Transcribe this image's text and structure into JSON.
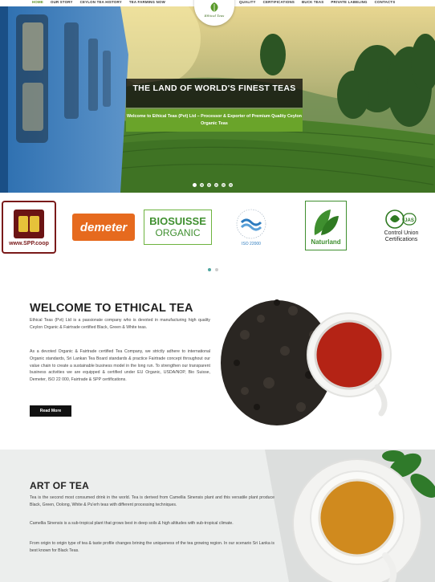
{
  "nav": {
    "left": [
      "HOME",
      "OUR STORY",
      "CEYLON TEA HISTORY",
      "TEA FARMING NOW"
    ],
    "right": [
      "QUALITY",
      "CERTIFICATIONS",
      "BUCK TEAS",
      "PRIVATE LABELING",
      "CONTACTS"
    ],
    "logo_text": "Ethical Teas"
  },
  "hero": {
    "title": "THE LAND OF WORLD'S FINEST TEAS",
    "subtitle": "Welcome to Ethical Teas (Pvt) Ltd – Processor & Exporter of Premium Quality Ceylon Organic Teas",
    "slide_count": 6,
    "active_slide": 1
  },
  "certifications": {
    "spp_label": "www.SPP.coop",
    "demeter_label": "demeter",
    "biosuisse_line1": "BIOSUISSE",
    "biosuisse_line2": "ORGANIC",
    "iso_label": "ISO 22000",
    "naturland_label": "Naturland",
    "cu_badge": "JAS",
    "cu_label_line1": "Control Union",
    "cu_label_line2": "Certifications",
    "page_count": 2,
    "active_page": 1
  },
  "welcome": {
    "title": "WELCOME TO ETHICAL TEA",
    "para1": "Ethical Teas (Pvt) Ltd is a passionate company who is devoted in manufacturing high quality Ceylon Organic & Fairtrade certified Black, Green & White teas.",
    "para2": "As a devoted Organic & Fairtrade certified Tea Company, we strictly adhere to international Organic standards, Sri Lankan Tea Board standards & practice Fairtrade concept throughout our value chain to create a sustainable business model in the long run. To strengthen our transparent business activities we are equipped & certified under EU Organic, USDA/NOP, Bio Suisse, Demeter, ISO 22 000, Fairtrade & SPP certifications.",
    "button": "Read More"
  },
  "art": {
    "title": "ART OF TEA",
    "para1": "Tea is the second most consumed drink in the world. Tea is derived from Camellia Sinensis plant and this versatile plant produce Black, Green, Oolong, White & Pu'erh teas with different processing techniques.",
    "para2": "Camellia Sinensis is a sub-tropical plant that grows best in deep soils & high altitudes with sub-tropical climate.",
    "para3": "From origin to origin type of tea & taste profile changes brining the uniqueness of the tea growing region. In our scenario Sri Lanka is best known for Black Teas."
  },
  "colors": {
    "accent_green": "#6aa42a",
    "demeter_orange": "#e66a1e",
    "spp_maroon": "#6b1414",
    "iso_blue": "#2c7bbf"
  }
}
